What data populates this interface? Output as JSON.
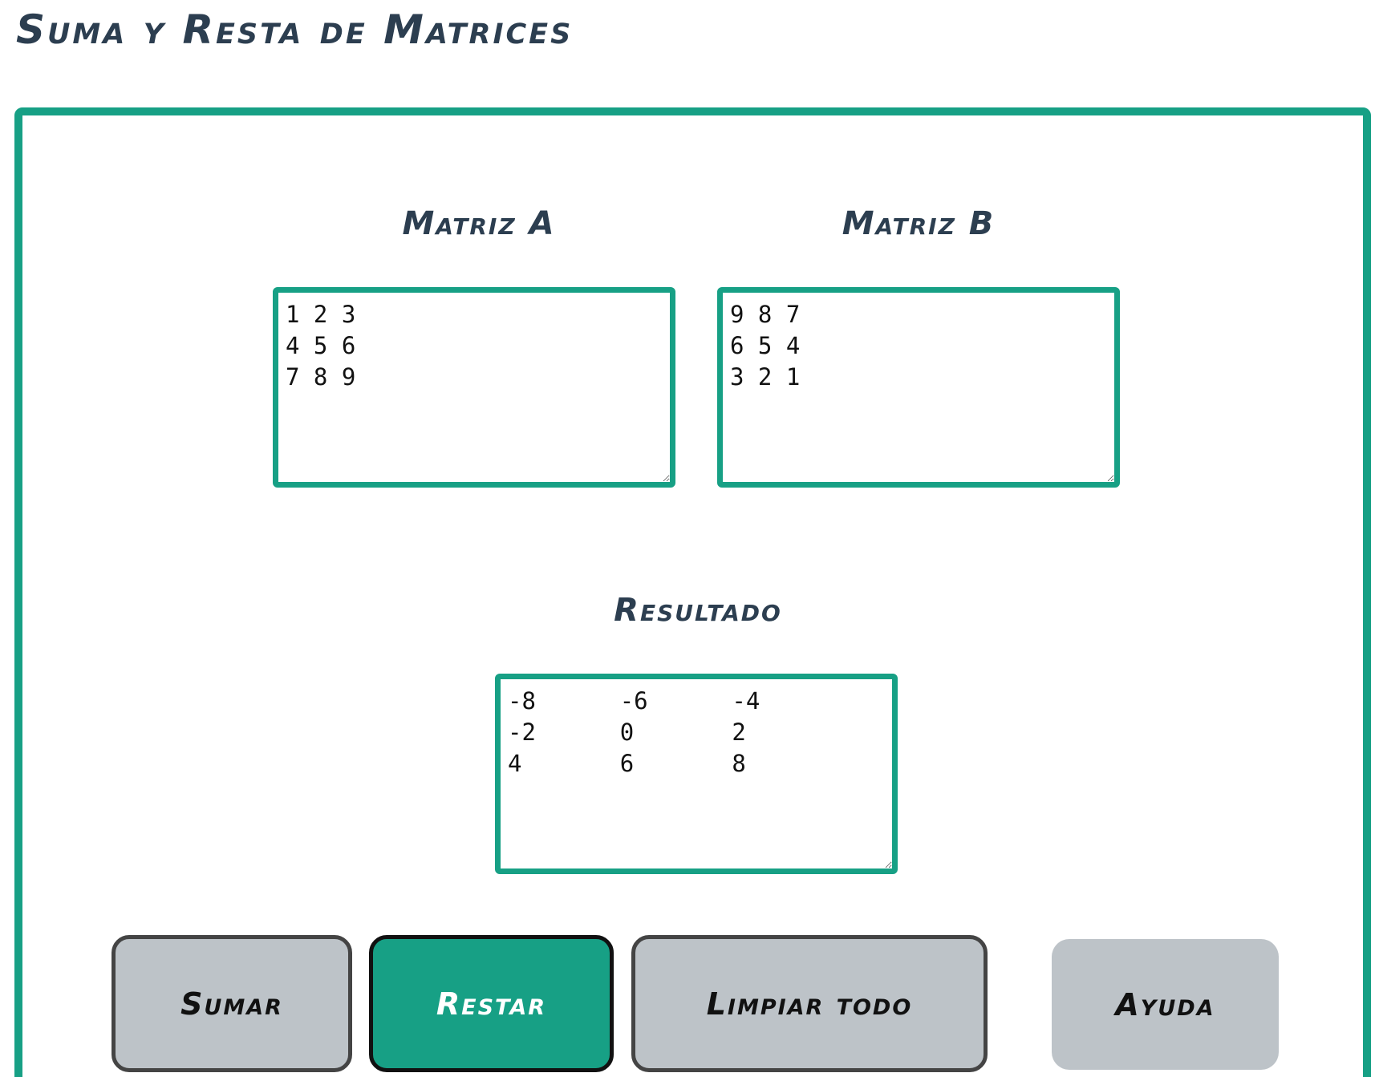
{
  "page": {
    "title": "Suma y Resta de Matrices"
  },
  "matrices": {
    "a": {
      "label": "Matriz A",
      "value": "1 2 3\n4 5 6\n7 8 9"
    },
    "b": {
      "label": "Matriz B",
      "value": "9 8 7\n6 5 4\n3 2 1"
    },
    "result": {
      "label": "Resultado",
      "value": "-8\t-6\t-4\n-2\t0\t2\n4\t6\t8"
    }
  },
  "buttons": {
    "sumar": "Sumar",
    "restar": "Restar",
    "limpiar": "Limpiar todo",
    "ayuda": "Ayuda"
  },
  "colors": {
    "accent": "#17a085",
    "heading": "#2c3e50",
    "button_gray": "#bdc3c8"
  }
}
